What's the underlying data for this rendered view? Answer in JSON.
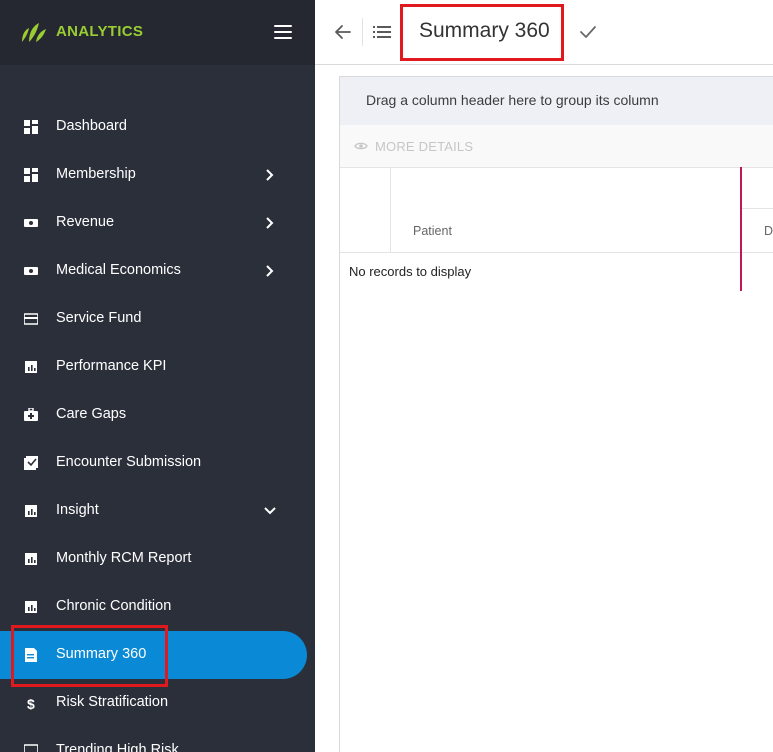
{
  "brand": {
    "name": "ANALYTICS",
    "accent": "#9acd32"
  },
  "sidebar": {
    "items": [
      {
        "label": "Dashboard",
        "icon": "dashboard-icon",
        "expandable": false
      },
      {
        "label": "Membership",
        "icon": "dashboard-icon",
        "expandable": true,
        "chevron": "right"
      },
      {
        "label": "Revenue",
        "icon": "money-icon",
        "expandable": true,
        "chevron": "right"
      },
      {
        "label": "Medical Economics",
        "icon": "money-icon",
        "expandable": true,
        "chevron": "right"
      },
      {
        "label": "Service Fund",
        "icon": "card-icon",
        "expandable": false
      },
      {
        "label": "Performance KPI",
        "icon": "chart-icon",
        "expandable": false
      },
      {
        "label": "Care Gaps",
        "icon": "medical-kit-icon",
        "expandable": false
      },
      {
        "label": "Encounter Submission",
        "icon": "checklist-icon",
        "expandable": false
      },
      {
        "label": "Insight",
        "icon": "chart-icon",
        "expandable": true,
        "chevron": "down"
      },
      {
        "label": "Monthly RCM Report",
        "icon": "chart-icon",
        "expandable": false
      },
      {
        "label": "Chronic Condition",
        "icon": "chart-icon",
        "expandable": false
      },
      {
        "label": "Summary 360",
        "icon": "report-icon",
        "expandable": false,
        "active": true
      },
      {
        "label": "Risk Stratification",
        "icon": "dollar-icon",
        "expandable": false
      },
      {
        "label": "Trending High Risk",
        "icon": "monitor-icon",
        "expandable": false
      }
    ],
    "active_color": "#0a8ad6"
  },
  "header": {
    "title": "Summary 360"
  },
  "grid": {
    "group_hint": "Drag a column header here to group its column",
    "more_details": "MORE DETAILS",
    "columns": [
      "Patient",
      "Da"
    ],
    "empty_message": "No records to display"
  },
  "highlight_color": "#e0191f"
}
